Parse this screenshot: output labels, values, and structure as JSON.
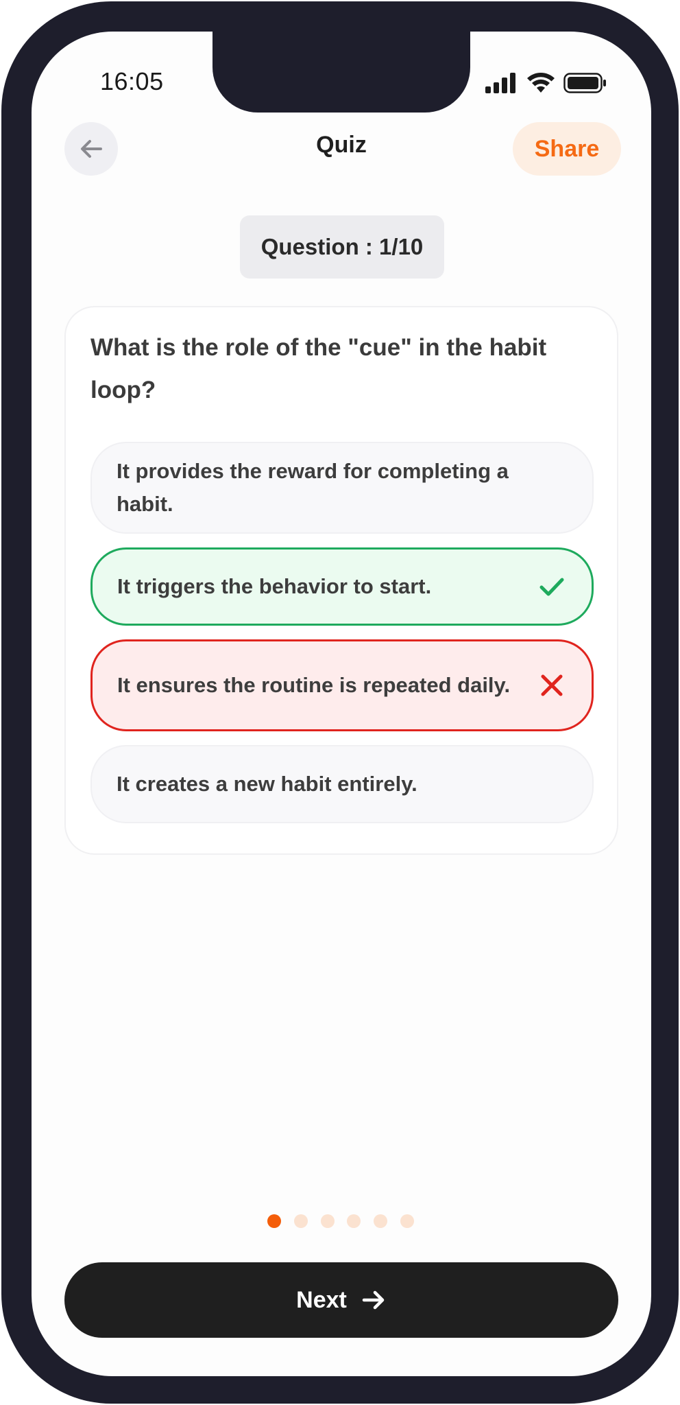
{
  "status_bar": {
    "time": "16:05",
    "icons": [
      "cellular-signal-icon",
      "wifi-icon",
      "battery-icon"
    ]
  },
  "header": {
    "back_icon": "arrow-left-icon",
    "title": "Quiz",
    "share_label": "Share"
  },
  "question": {
    "badge": "Question : 1/10",
    "text": "What is the role of the \"cue\" in the habit loop?",
    "options": [
      {
        "label": "It provides the reward for completing a habit.",
        "state": "neutral"
      },
      {
        "label": "It triggers the behavior to start.",
        "state": "correct",
        "icon": "check-icon"
      },
      {
        "label": "It ensures the routine is repeated daily.",
        "state": "wrong",
        "icon": "x-icon"
      },
      {
        "label": "It creates a new habit entirely.",
        "state": "neutral"
      }
    ]
  },
  "pagination": {
    "total_dots": 6,
    "active_index": 0
  },
  "footer": {
    "next_label": "Next",
    "next_icon": "arrow-right-icon"
  },
  "colors": {
    "accent": "#f56a14",
    "share_bg": "#fdeee2",
    "correct_border": "#1eaa5d",
    "correct_bg": "#ebfbf0",
    "wrong_border": "#e0241e",
    "wrong_bg": "#feecec",
    "button_dark": "#1f1f1f",
    "frame": "#1e1e2c"
  }
}
